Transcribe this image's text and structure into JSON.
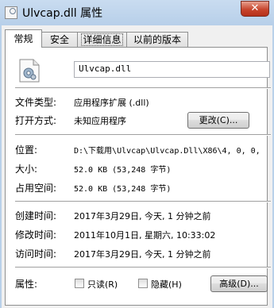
{
  "window": {
    "title": "Ulvcap.dll 属性",
    "close_glyph": "✕"
  },
  "tabs": [
    {
      "label": "常规"
    },
    {
      "label": "安全"
    },
    {
      "label": "详细信息"
    },
    {
      "label": "以前的版本"
    }
  ],
  "general": {
    "file_name": "Ulvcap.dll",
    "type_label": "文件类型:",
    "type_value": "应用程序扩展 (.dll)",
    "opens_with_label": "打开方式:",
    "opens_with_value": "未知应用程序",
    "change_button": "更改(C)...",
    "location_label": "位置:",
    "location_value": "D:\\下载用\\Ulvcap\\Ulvcap.Dll\\X86\\4, 0, 0,",
    "size_label": "大小:",
    "size_value": "52.0 KB (53,248 字节)",
    "size_on_disk_label": "占用空间:",
    "size_on_disk_value": "52.0 KB (53,248 字节)",
    "created_label": "创建时间:",
    "created_value": "2017年3月29日, 今天, 1 分钟之前",
    "modified_label": "修改时间:",
    "modified_value": "2011年10月1日, 星期六, 10:33:02",
    "accessed_label": "访问时间:",
    "accessed_value": "2017年3月29日, 今天, 1 分钟之前",
    "attributes_label": "属性:",
    "readonly_label": "只读(R)",
    "hidden_label": "隐藏(H)",
    "advanced_button": "高级(D)..."
  }
}
